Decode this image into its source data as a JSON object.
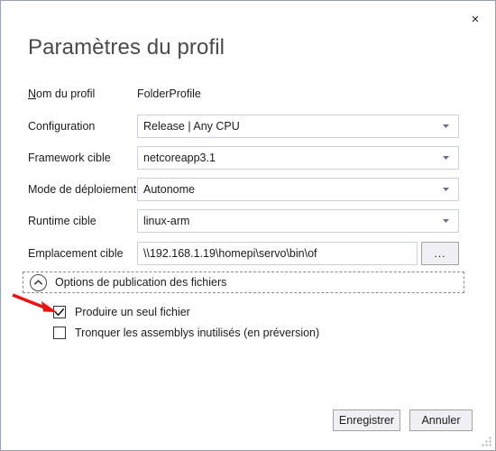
{
  "window": {
    "close_label": "×",
    "border_color": "#9aa0b4"
  },
  "title": "Paramètres du profil",
  "profile_name": {
    "label_prefix": "N",
    "label_rest": "om du profil",
    "value": "FolderProfile"
  },
  "fields": [
    {
      "label": "Configuration",
      "value": "Release | Any CPU"
    },
    {
      "label": "Framework cible",
      "value": "netcoreapp3.1"
    },
    {
      "label": "Mode de déploiement",
      "value": "Autonome"
    },
    {
      "label": "Runtime cible",
      "value": "linux-arm"
    }
  ],
  "location": {
    "label": "Emplacement cible",
    "value": "\\\\192.168.1.19\\homepi\\servo\\bin\\of",
    "browse_label": "..."
  },
  "expander": {
    "label": "Options de publication des fichiers",
    "icon": "chevron-up-circle-icon",
    "expanded": true
  },
  "checkboxes": [
    {
      "label": "Produire un seul fichier",
      "checked": true
    },
    {
      "label": "Tronquer les assemblys inutilisés (en préversion)",
      "checked": false
    }
  ],
  "footer": {
    "save_label": "Enregistrer",
    "cancel_label": "Annuler"
  },
  "annotation": {
    "type": "arrow",
    "color": "#ee1111",
    "points_at": "Produire un seul fichier"
  }
}
